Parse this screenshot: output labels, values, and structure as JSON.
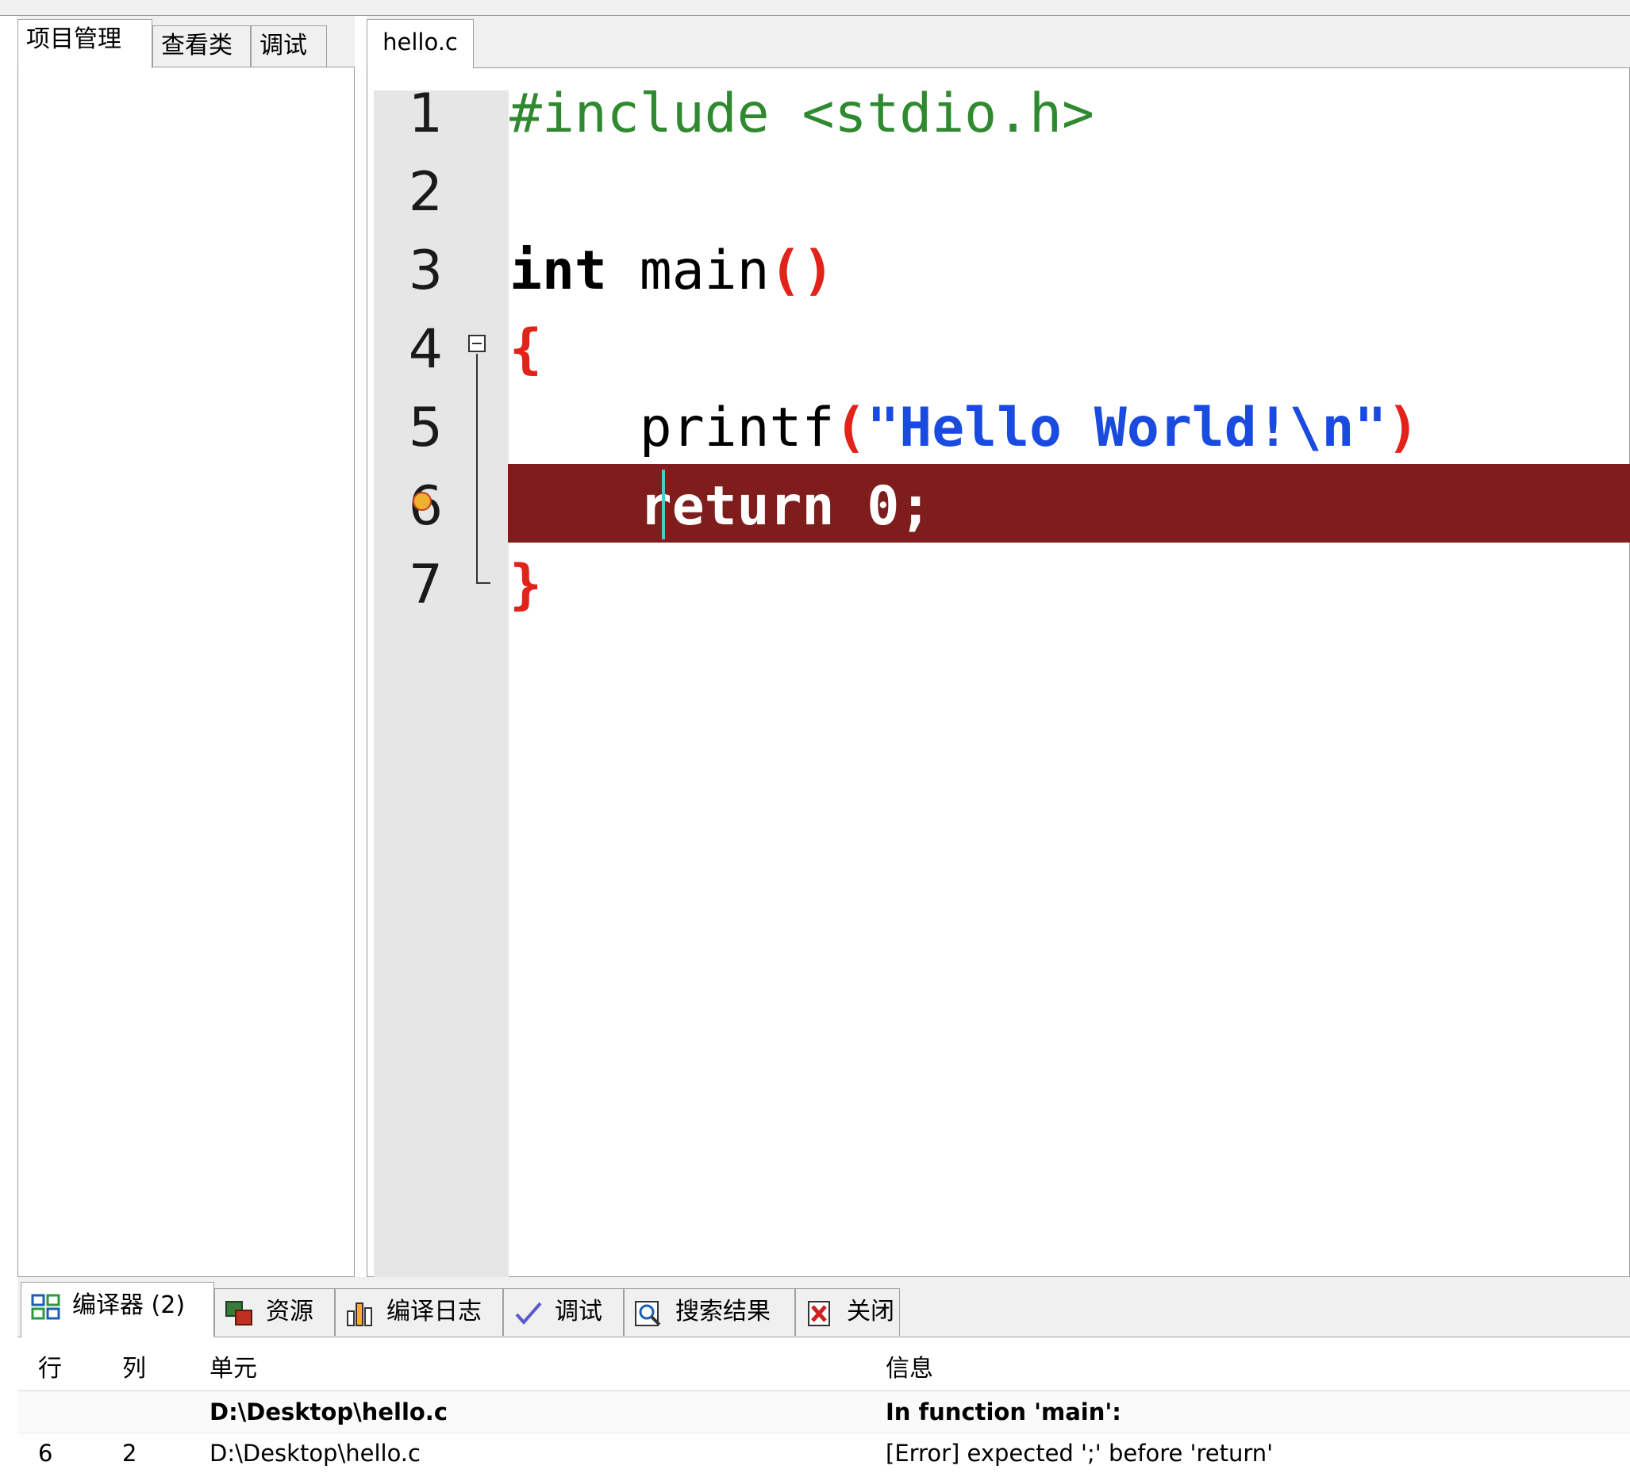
{
  "left_panel": {
    "tabs": [
      {
        "label": "项目管理",
        "active": true
      },
      {
        "label": "查看类",
        "active": false
      },
      {
        "label": "调试",
        "active": false
      }
    ]
  },
  "editor": {
    "tab_label": "hello.c",
    "lines": [
      {
        "number": "1",
        "text": "#include <stdio.h>"
      },
      {
        "number": "2",
        "text": ""
      },
      {
        "number": "3",
        "keyword": "int",
        "name": " main",
        "parens": "()"
      },
      {
        "number": "4",
        "brace": "{"
      },
      {
        "number": "5",
        "indent": "    ",
        "func": "printf",
        "open": "(",
        "string": "\"Hello World!\\n\"",
        "close": ")"
      },
      {
        "number": "6",
        "indent": "    ",
        "text": "return 0;",
        "error": true
      },
      {
        "number": "7",
        "brace": "}"
      }
    ],
    "colors": {
      "error_line_bg": "#7e1d1b",
      "include": "#2f8a2f",
      "punct": "#e2231a",
      "string": "#1a4be0"
    }
  },
  "bottom_panel": {
    "tabs": [
      {
        "label": "编译器 (2)",
        "icon": "compiler-grid-icon",
        "active": true
      },
      {
        "label": "资源",
        "icon": "resources-icon",
        "active": false
      },
      {
        "label": "编译日志",
        "icon": "bar-chart-icon",
        "active": false
      },
      {
        "label": "调试",
        "icon": "checkmark-icon",
        "active": false
      },
      {
        "label": "搜索结果",
        "icon": "magnifier-icon",
        "active": false
      },
      {
        "label": "关闭",
        "icon": "close-icon",
        "active": false
      }
    ],
    "table": {
      "headers": {
        "line": "行",
        "col": "列",
        "unit": "单元",
        "message": "信息"
      },
      "rows": [
        {
          "line": "",
          "col": "",
          "unit": "D:\\Desktop\\hello.c",
          "message": "In function 'main':",
          "bold": true
        },
        {
          "line": "6",
          "col": "2",
          "unit": "D:\\Desktop\\hello.c",
          "message": "[Error] expected ';' before 'return'",
          "bold": false
        }
      ]
    }
  }
}
